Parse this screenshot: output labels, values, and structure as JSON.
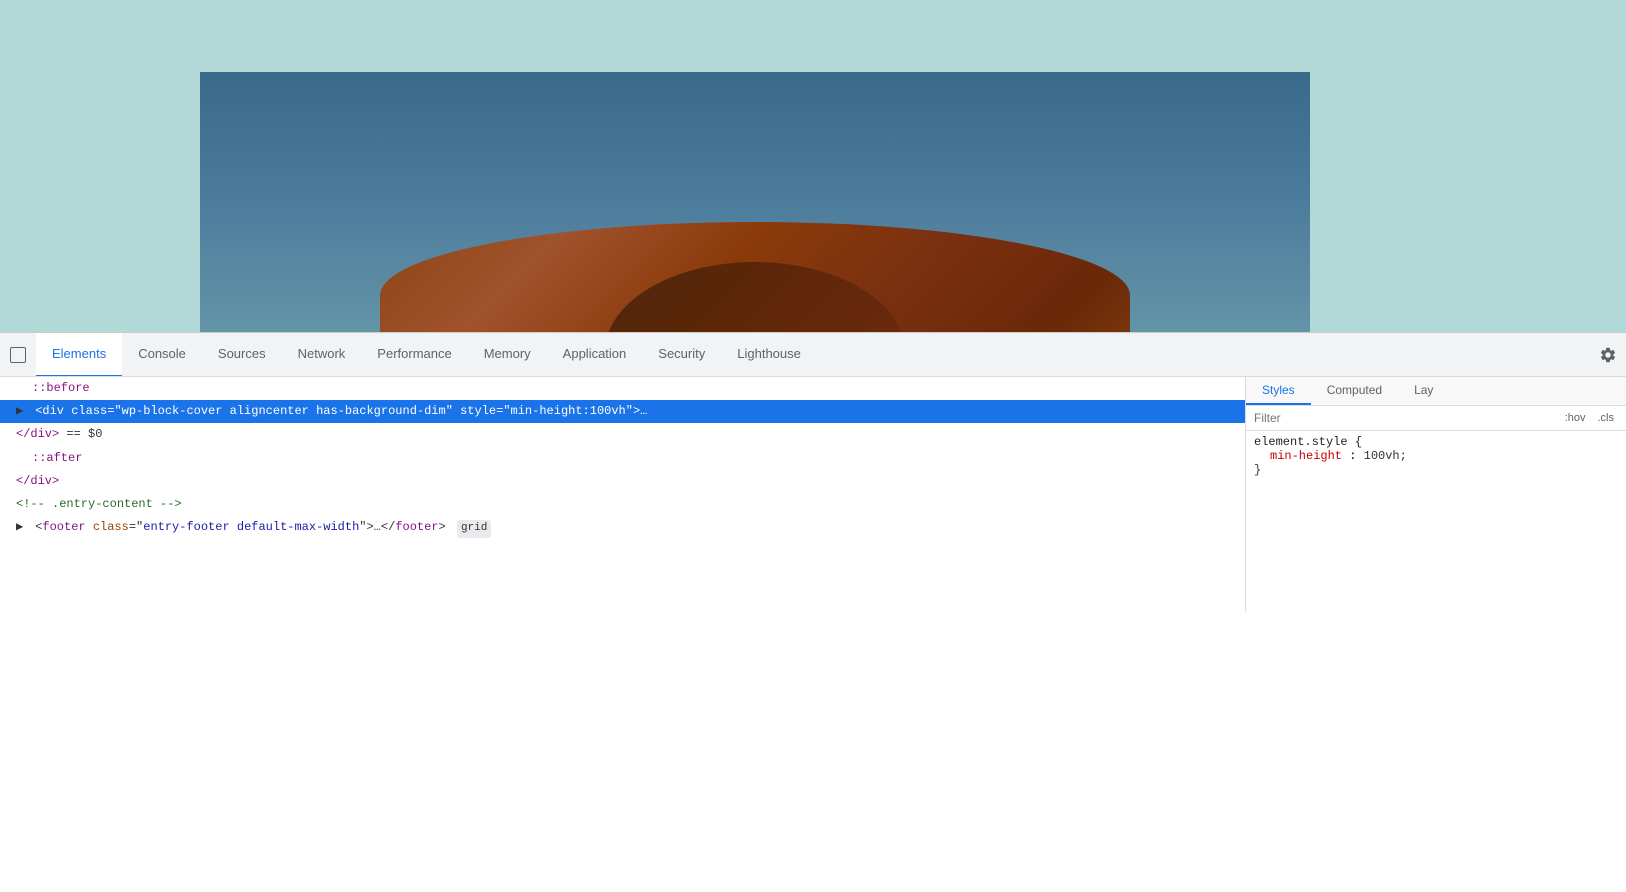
{
  "browser": {
    "viewport_bg": "#b2d8d8"
  },
  "devtools": {
    "tabs": [
      {
        "id": "elements",
        "label": "Elements",
        "active": true
      },
      {
        "id": "console",
        "label": "Console",
        "active": false
      },
      {
        "id": "sources",
        "label": "Sources",
        "active": false
      },
      {
        "id": "network",
        "label": "Network",
        "active": false
      },
      {
        "id": "performance",
        "label": "Performance",
        "active": false
      },
      {
        "id": "memory",
        "label": "Memory",
        "active": false
      },
      {
        "id": "application",
        "label": "Application",
        "active": false
      },
      {
        "id": "security",
        "label": "Security",
        "active": false
      },
      {
        "id": "lighthouse",
        "label": "Lighthouse",
        "active": false
      }
    ],
    "styles_tabs": [
      {
        "label": "Styles",
        "active": true
      },
      {
        "label": "Computed",
        "active": false
      },
      {
        "label": "Lay",
        "active": false
      }
    ],
    "filter_placeholder": "Filter",
    "filter_hov": ":hov",
    "filter_cls": ".cls",
    "elements": [
      {
        "id": "before-pseudo",
        "indent": 1,
        "content": "::before",
        "type": "pseudo",
        "highlighted": false
      },
      {
        "id": "div-cover",
        "indent": 1,
        "type": "highlighted",
        "arrow": "▶",
        "tag_open": "<div class=\"",
        "class_val": "wp-block-cover aligncenter has-background-dim",
        "tag_mid": "\" style=\"",
        "style_attr": "min-height:100vh",
        "tag_close": "\">…",
        "dollar": " == $0",
        "highlighted": true
      },
      {
        "id": "div-close",
        "indent": 1,
        "content": "</div> == $0",
        "type": "normal",
        "highlighted": false
      },
      {
        "id": "after-pseudo",
        "indent": 1,
        "content": "::after",
        "type": "pseudo",
        "highlighted": false
      },
      {
        "id": "div-close2",
        "indent": 0,
        "content": "</div>",
        "type": "normal",
        "highlighted": false
      },
      {
        "id": "comment",
        "indent": 0,
        "content": "<!-- .entry-content -->",
        "type": "comment",
        "highlighted": false
      },
      {
        "id": "footer",
        "indent": 0,
        "arrow": "▶",
        "type": "footer",
        "tag": "<footer class=\"",
        "class_val": "entry-footer default-max-width",
        "tag_close": "\">…</footer>",
        "badge": "grid",
        "highlighted": false
      }
    ],
    "css_rule": {
      "selector": "element.style {",
      "property": "min-height",
      "value": "100vh;",
      "close": "}"
    }
  }
}
